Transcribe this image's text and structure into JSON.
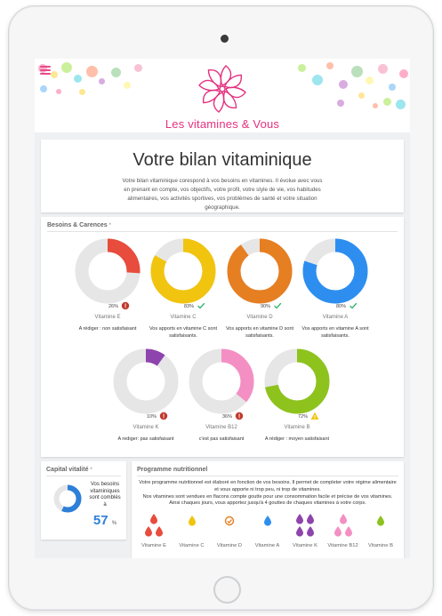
{
  "header": {
    "brand": "Les vitamines & Vous",
    "menu_icon": "hamburger-menu-icon",
    "logo_icon": "flower-logo-icon"
  },
  "intro": {
    "title": "Votre bilan vitaminique",
    "text": "Votre bilan vitaminique corespond à vos besoins en vitamines. Il évolue avec vous en prenant en compte, vos objectifs, votre profil, votre style de vie, vos habitudes alimentaires, vos activités sportives, vos problèmes de santé et votre situation géographique."
  },
  "besoins": {
    "title": "Besoins & Carences",
    "info_icon": "*",
    "vitamins": [
      {
        "name": "Vitamine E",
        "percent": 26,
        "percent_label": "26%",
        "color": "#e74c3c",
        "status": "alert",
        "description": "A rédiger : non satisfaisant"
      },
      {
        "name": "Vitamine C",
        "percent": 83,
        "percent_label": "83%",
        "color": "#f1c40f",
        "status": "ok",
        "description": "Vos apports en vitamine C sont satisfaisants."
      },
      {
        "name": "Vitamine D",
        "percent": 90,
        "percent_label": "90%",
        "color": "#e67e22",
        "status": "ok",
        "description": "Vos apports en vitamine D sont satisfaisants."
      },
      {
        "name": "Vitamine A",
        "percent": 80,
        "percent_label": "80%",
        "color": "#2d8ef0",
        "status": "ok",
        "description": "Vos apports en vitamine A sont satisfaisants."
      },
      {
        "name": "Vitamine K",
        "percent": 10,
        "percent_label": "10%",
        "color": "#8e44ad",
        "status": "alert",
        "description": "A rediger: pas satisfaisant"
      },
      {
        "name": "Vitamine B12",
        "percent": 36,
        "percent_label": "36%",
        "color": "#f48fc3",
        "status": "alert",
        "description": "c'est pas satisfaisant"
      },
      {
        "name": "Vitamine B",
        "percent": 72,
        "percent_label": "72%",
        "color": "#8ec31e",
        "status": "warning",
        "description": "A rédiger : moyen satisfaisant"
      }
    ]
  },
  "capital": {
    "title": "Capital vitalité",
    "info_icon": "*",
    "text": "Vos besoins vitaminiques sont comblés à",
    "value": "57",
    "unit": "%",
    "percent": 57,
    "color": "#2d7fd8"
  },
  "programme": {
    "title": "Programme nutritionnel",
    "text1": "Votre programme nutritionnel est élaboré en fonction de vos besoins. Il permet de completer votre régime alimentaire et vous apporte ni trop peu, ni trop de vitamines.",
    "text2": "Nos vitamines sont vendues en flacons compte goutte pour une consommation facile et précise de vos vitamines.",
    "text3": "Ainsi chaques jours, vous apportez jusqu'à 4 gouttes de chaques vitamines à votre corps.",
    "doses": [
      {
        "name": "Vitamine E",
        "drops": 3,
        "color": "#e74c3c",
        "icon": "drop-icon"
      },
      {
        "name": "Vitamine C",
        "drops": 1,
        "color": "#f1c40f",
        "icon": "drop-icon"
      },
      {
        "name": "Vitamine D",
        "drops": 0,
        "color": "#e67e22",
        "icon": "check-circle-icon"
      },
      {
        "name": "Vitamine A",
        "drops": 1,
        "color": "#2d8ef0",
        "icon": "drop-icon"
      },
      {
        "name": "Vitamine K",
        "drops": 4,
        "color": "#8e44ad",
        "icon": "drop-icon"
      },
      {
        "name": "Vitamine B12",
        "drops": 3,
        "color": "#f48fc3",
        "icon": "drop-icon"
      },
      {
        "name": "Vitamine B",
        "drops": 1,
        "color": "#8ec31e",
        "icon": "drop-icon"
      }
    ]
  }
}
